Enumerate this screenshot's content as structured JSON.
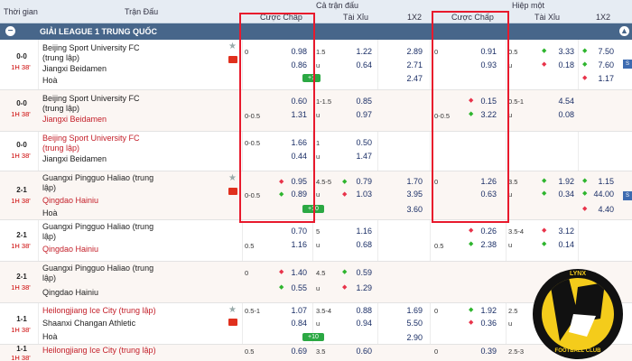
{
  "header": {
    "col_time": "Thời gian",
    "col_match": "Trận Đấu",
    "group_full": "Cả trận đấu",
    "group_half": "Hiệp một",
    "handicap": "Cược Chấp",
    "overunder": "Tài Xỉu",
    "onextwo": "1X2",
    "handicap2": "Cược Chấp",
    "overunder2": "Tài Xỉu",
    "onextwo2": "1X2"
  },
  "league": {
    "name": "GIẢI LEAGUE 1 TRUNG QUỐC",
    "icon": "minus-icon"
  },
  "rows": [
    {
      "score": "0-0",
      "time": "1H 38'",
      "team1": "Beijing Sport University FC",
      "team1b": "(trung lập)",
      "team2": "Jiangxi Beidamen",
      "draw": "Hoà",
      "hc": "0",
      "hc_odd1": "0.98",
      "hc_odd2": "0.86",
      "ou": "1.5",
      "ou_u": "u",
      "ou_odd1": "1.22",
      "ou_odd2": "0.64",
      "x1": "2.89",
      "x2": "2.71",
      "x3": "2.47",
      "btn": "+1",
      "h_hc": "0",
      "h_odd1": "0.91",
      "h_odd2": "0.93",
      "h_ou": "0.5",
      "h_ou_u": "u",
      "h_ou1": "3.33",
      "h_ou2": "0.18",
      "h_x1": "7.50",
      "h_x2": "7.60",
      "h_x3": "1.17"
    },
    {
      "score": "0-0",
      "time": "1H 38'",
      "team1": "Beijing Sport University FC",
      "team1b": "(trung lập)",
      "team2": "Jiangxi Beidamen",
      "hc": "0-0.5",
      "hc_odd1": "0.60",
      "hc_odd2": "1.31",
      "ou": "1-1.5",
      "ou_u": "u",
      "ou_odd1": "0.85",
      "ou_odd2": "0.97",
      "h_hc": "0-0.5",
      "h_odd1": "0.15",
      "h_odd2": "3.22",
      "h_ou": "0.5-1",
      "h_ou_u": "u",
      "h_ou1": "4.54",
      "h_ou2": "0.08"
    },
    {
      "score": "0-0",
      "time": "1H 38'",
      "team1": "Beijing Sport University FC",
      "team1b": "(trung lập)",
      "team2": "Jiangxi Beidamen",
      "hc": "0-0.5",
      "hc_odd1": "1.66",
      "hc_odd2": "0.44",
      "ou": "1",
      "ou_u": "u",
      "ou_odd1": "0.50",
      "ou_odd2": "1.47"
    },
    {
      "score": "2-1",
      "time": "1H 38'",
      "team1": "Guangxi Pingguo Haliao (trung",
      "team1b": "lập)",
      "team2": "Qingdao Hainiu",
      "draw": "Hoà",
      "hc": "0-0.5",
      "hc_odd1": "0.95",
      "hc_odd2": "0.89",
      "ou": "4.5-5",
      "ou_u": "u",
      "ou_odd1": "0.79",
      "ou_odd2": "1.03",
      "x1": "1.70",
      "x2": "3.95",
      "x3": "3.60",
      "btn": "+10",
      "h_hc": "0",
      "h_odd1": "1.26",
      "h_odd2": "0.63",
      "h_ou": "3.5",
      "h_ou_u": "u",
      "h_ou1": "1.92",
      "h_ou2": "0.34",
      "h_x1": "1.15",
      "h_x2": "44.00",
      "h_x3": "4.40"
    },
    {
      "score": "2-1",
      "time": "1H 38'",
      "team1": "Guangxi Pingguo Haliao (trung",
      "team1b": "lập)",
      "team2": "Qingdao Hainiu",
      "hc": "0.5",
      "hc_odd1": "0.70",
      "hc_odd2": "1.16",
      "ou": "5",
      "ou_u": "u",
      "ou_odd1": "1.16",
      "ou_odd2": "0.68",
      "h_hc": "0.5",
      "h_odd1": "0.26",
      "h_odd2": "2.38",
      "h_ou": "3.5-4",
      "h_ou_u": "u",
      "h_ou1": "3.12",
      "h_ou2": "0.14"
    },
    {
      "score": "2-1",
      "time": "1H 38'",
      "team1": "Guangxi Pingguo Haliao (trung",
      "team1b": "lập)",
      "team2": "Qingdao Hainiu",
      "hc": "0",
      "hc_odd1": "1.40",
      "hc_odd2": "0.55",
      "ou": "4.5",
      "ou_u": "u",
      "ou_odd1": "0.59",
      "ou_odd2": "1.29"
    },
    {
      "score": "1-1",
      "time": "1H 38'",
      "team1": "Heilongjiang Ice City (trung lập)",
      "team2": "Shaanxi Changan Athletic",
      "draw": "Hoà",
      "hc": "0.5-1",
      "hc_odd1": "1.07",
      "hc_odd2": "0.84",
      "ou": "3.5-4",
      "ou_u": "u",
      "ou_odd1": "0.88",
      "ou_odd2": "0.94",
      "x1": "1.69",
      "x2": "5.50",
      "x3": "2.90",
      "btn": "+10",
      "h_hc": "0",
      "h_odd1": "1.92",
      "h_odd2": "0.36",
      "h_ou": "2.5",
      "h_ou_u": "u"
    },
    {
      "score": "1-1",
      "time": "1H 38'",
      "team1": "Heilongjiang Ice City (trung lập)",
      "hc": "0.5",
      "hc_odd1": "0.69",
      "ou": "3.5",
      "ou_odd1": "0.60",
      "h_hc": "0",
      "h_odd1": "0.39",
      "h_ou": "2.5-3"
    }
  ],
  "logo": {
    "top": "LYNX",
    "bottom": "FOOTBALL CLUB"
  },
  "colors": {
    "accent_red": "#e8192c",
    "header_bar": "#47668a",
    "odd_blue": "#1a2e66",
    "up_green": "#2eb52e",
    "down_red": "#e8334a"
  }
}
